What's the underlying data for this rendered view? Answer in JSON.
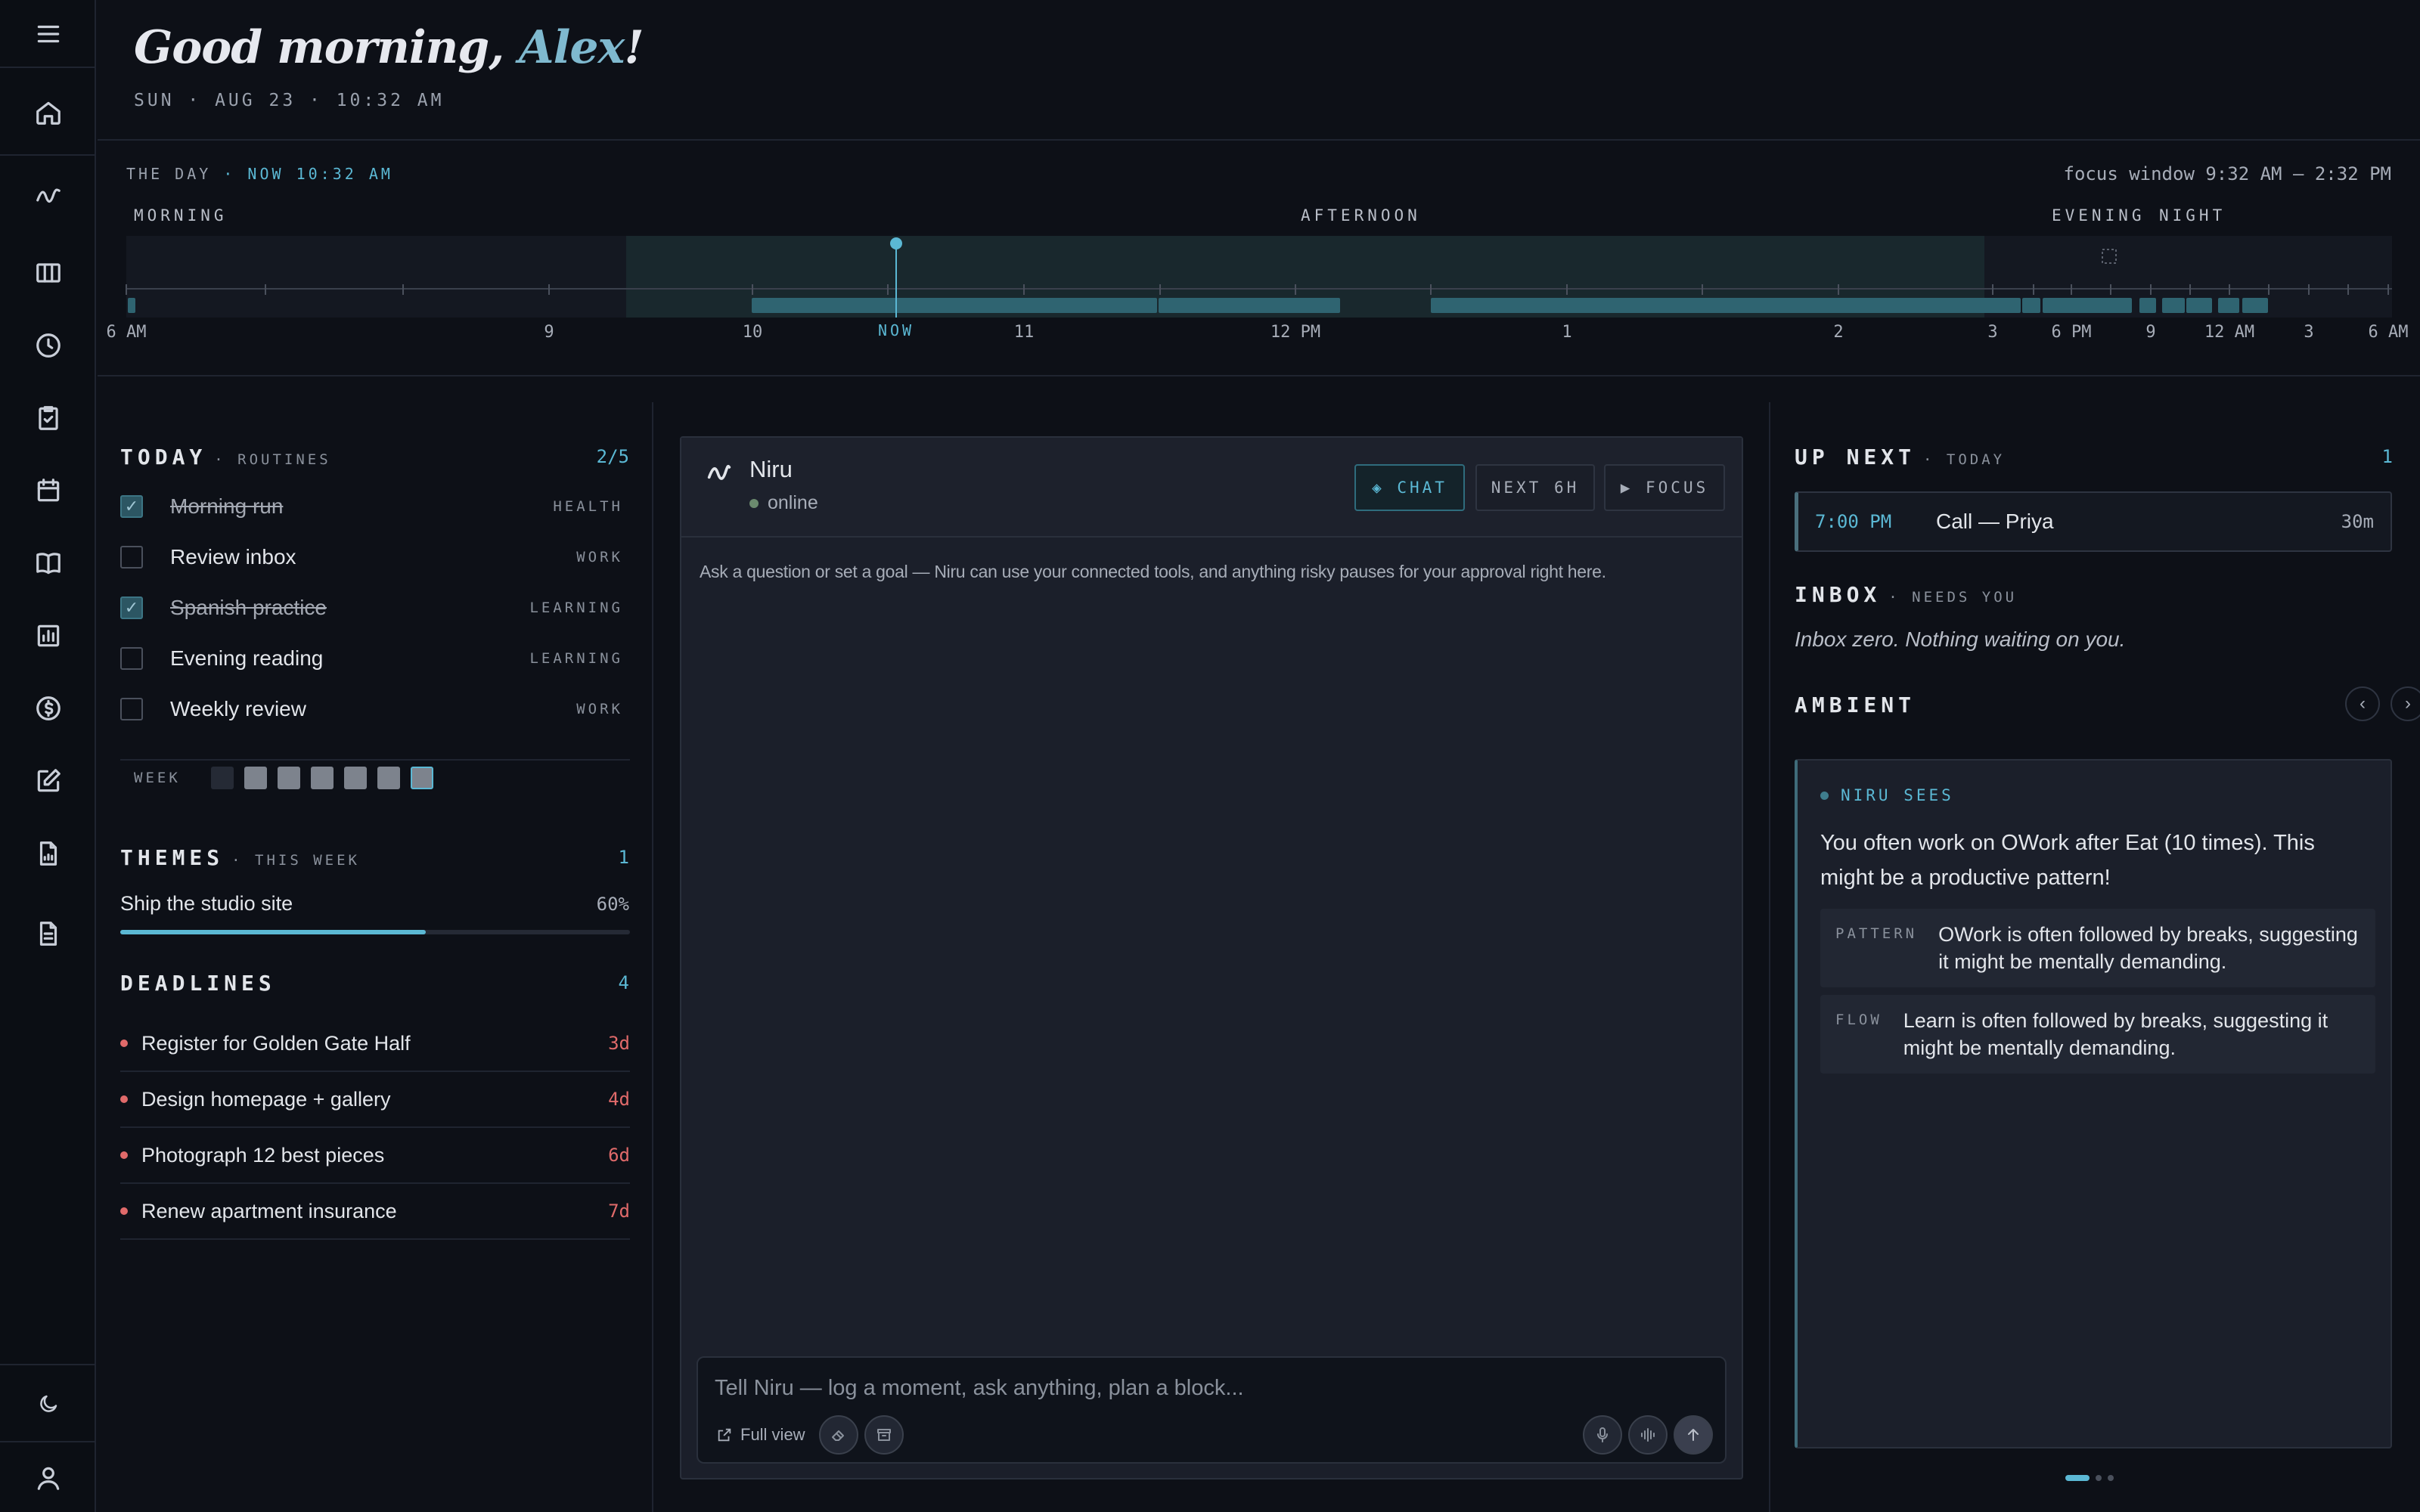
{
  "sidebar": {
    "items": [
      {
        "icon": "menu-icon"
      },
      {
        "icon": "home-icon"
      },
      {
        "icon": "activity-icon"
      },
      {
        "icon": "columns-icon"
      },
      {
        "icon": "clock-icon"
      },
      {
        "icon": "clipboard-check-icon"
      },
      {
        "icon": "calendar-icon"
      },
      {
        "icon": "book-icon"
      },
      {
        "icon": "chart-icon"
      },
      {
        "icon": "dollar-icon"
      },
      {
        "icon": "edit-icon"
      },
      {
        "icon": "file-chart-icon"
      },
      {
        "icon": "document-icon"
      },
      {
        "icon": "moon-icon"
      },
      {
        "icon": "user-icon"
      }
    ]
  },
  "header": {
    "greeting_prefix": "Good morning, ",
    "name": "Alex",
    "greeting_suffix": "!",
    "date_line": "SUN · AUG 23 · 10:32 AM"
  },
  "day": {
    "label": "THE DAY",
    "now_label": "· NOW 10:32 AM",
    "focus_window": "focus window 9:32 AM – 2:32 PM",
    "periods": {
      "morning": "MORNING",
      "afternoon": "AFTERNOON",
      "evening": "EVENING",
      "night": "NIGHT"
    },
    "now_marker": "NOW",
    "ticks": [
      "6 AM",
      "9",
      "10",
      "11",
      "12 PM",
      "1",
      "2",
      "3",
      "6 PM",
      "9",
      "12 AM",
      "3",
      "6 AM"
    ],
    "colors": {
      "accent": "#5bb8d4",
      "block": "#2f6471",
      "focus": "#1a2d31"
    }
  },
  "today": {
    "title": "TODAY",
    "subtitle": "· ROUTINES",
    "count": "2/5",
    "routines": [
      {
        "label": "Morning run",
        "category": "HEALTH",
        "done": true
      },
      {
        "label": "Review inbox",
        "category": "WORK",
        "done": false
      },
      {
        "label": "Spanish practice",
        "category": "LEARNING",
        "done": true
      },
      {
        "label": "Evening reading",
        "category": "LEARNING",
        "done": false
      },
      {
        "label": "Weekly review",
        "category": "WORK",
        "done": false
      }
    ],
    "week_label": "WEEK"
  },
  "themes": {
    "title": "THEMES",
    "subtitle": "· THIS WEEK",
    "count": "1",
    "items": [
      {
        "name": "Ship the studio site",
        "percent": "60%",
        "progress": 0.6
      }
    ]
  },
  "deadlines": {
    "title": "DEADLINES",
    "count": "4",
    "items": [
      {
        "label": "Register for Golden Gate Half",
        "days": "3d"
      },
      {
        "label": "Design homepage + gallery",
        "days": "4d"
      },
      {
        "label": "Photograph 12 best pieces",
        "days": "6d"
      },
      {
        "label": "Renew apartment insurance",
        "days": "7d"
      }
    ]
  },
  "chat": {
    "name": "Niru",
    "status": "online",
    "modes": [
      {
        "label": "◈ CHAT",
        "active": true
      },
      {
        "label": "NEXT 6H",
        "active": false
      },
      {
        "label": "▶ FOCUS",
        "active": false
      }
    ],
    "intro": "Ask a question or set a goal — Niru can use your connected tools, and anything risky pauses for your approval right here.",
    "input_placeholder": "Tell Niru — log a moment, ask anything, plan a block...",
    "full_view": "Full view"
  },
  "up_next": {
    "title": "UP NEXT",
    "subtitle": "· TODAY",
    "count": "1",
    "items": [
      {
        "time": "7:00 PM",
        "title": "Call — Priya",
        "duration": "30m"
      }
    ]
  },
  "inbox": {
    "title": "INBOX",
    "subtitle": "· NEEDS YOU",
    "empty_text": "Inbox zero. Nothing waiting on you."
  },
  "ambient": {
    "title": "AMBIENT",
    "tag": "NIRU SEES",
    "text": "You often work on OWork after Eat (10 times). This might be a productive pattern!",
    "insights": [
      {
        "kind": "PATTERN",
        "text": "OWork is often followed by breaks, suggesting it might be mentally demanding."
      },
      {
        "kind": "FLOW",
        "text": "Learn is often followed by breaks, suggesting it might be mentally demanding."
      }
    ]
  }
}
